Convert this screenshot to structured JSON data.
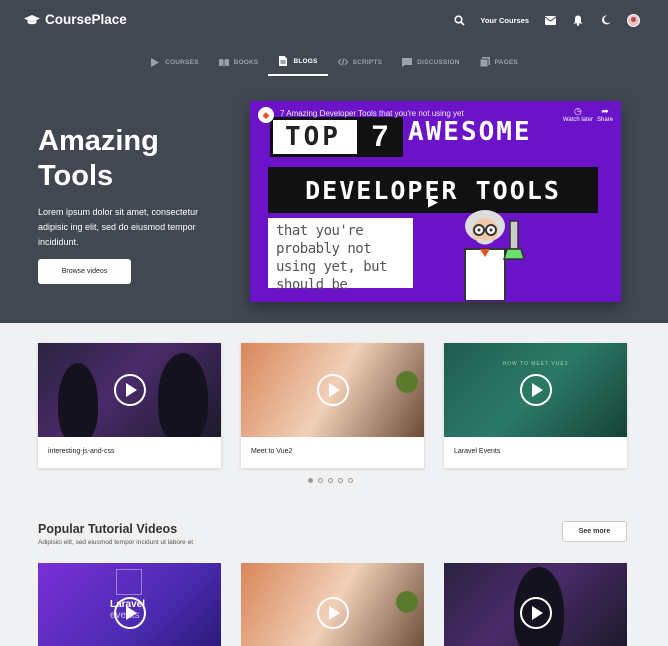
{
  "app": {
    "name": "CoursePlace"
  },
  "topnav": {
    "your_courses": "Your Courses",
    "icons": [
      "search-icon",
      "mail-icon",
      "bell-icon",
      "moon-icon",
      "avatar"
    ]
  },
  "tabs": [
    {
      "label": "COURSES",
      "icon": "play-icon",
      "active": false
    },
    {
      "label": "BOOKS",
      "icon": "book-icon",
      "active": false
    },
    {
      "label": "BLOGS",
      "icon": "document-icon",
      "active": true
    },
    {
      "label": "SCRIPTS",
      "icon": "code-icon",
      "active": false
    },
    {
      "label": "DISCUSSION",
      "icon": "chat-icon",
      "active": false
    },
    {
      "label": "PAGES",
      "icon": "pages-icon",
      "active": false
    }
  ],
  "hero": {
    "title_line1": "Amazing",
    "title_line2": "Tools",
    "text": "Lorem ipsum dolor sit amet, consectetur adipisic ing elit, sed do eiusmod tempor incididunt.",
    "button": "Browse videos"
  },
  "video": {
    "title": "7 Amazing Developer Tools that you're not using yet",
    "watch_later": "Watch later",
    "share": "Share",
    "thumb_line1a": "TOP",
    "thumb_line1b": "7",
    "thumb_line1c": "AWESOME",
    "thumb_line2": "DEVELOPER TOOLS",
    "thumb_line3": "that you're probably not using yet, but should be"
  },
  "featured": [
    {
      "title": "interesting-js-and-css",
      "thumb": "t1"
    },
    {
      "title": "Meet to Vue2",
      "thumb": "t2"
    },
    {
      "title": "Laravel Events",
      "thumb": "t3",
      "overlay": "HOW TO MEET VUE2"
    }
  ],
  "carousel": {
    "count": 5,
    "active": 0
  },
  "popular": {
    "title": "Popular Tutorial Videos",
    "subtitle": "Adipisici elit, sed eiusmod tempor incidunt ut labore et",
    "see_more": "See more",
    "cards": [
      {
        "overlay1": "Laravel",
        "overlay2": "events"
      },
      {},
      {}
    ]
  },
  "colors": {
    "header_bg": "#414852",
    "page_bg": "#f0f1f3",
    "video_bg": "#6a13c8"
  }
}
